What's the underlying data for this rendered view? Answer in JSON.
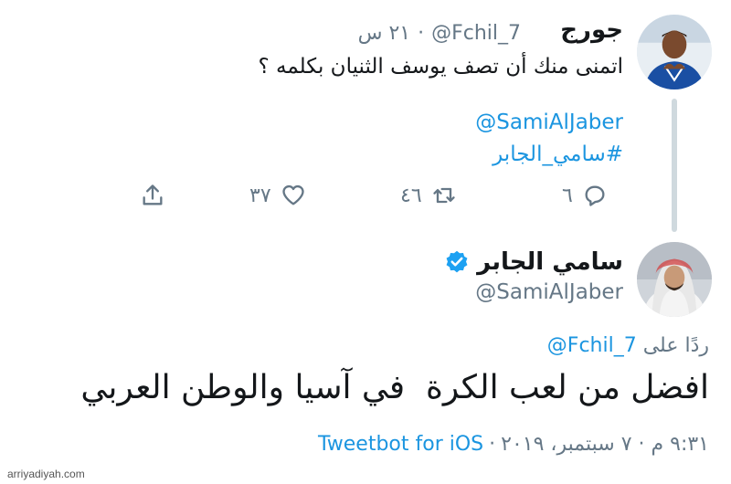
{
  "parent_tweet": {
    "display_name": "جورج",
    "handle": "@Fchil_7",
    "time": "٢١ س",
    "text": "اتمنى منك أن تصف يوسف الثنيان بكلمه ؟",
    "mention": "@SamiAlJaber",
    "hashtag": "#سامي_الجابر",
    "counts": {
      "replies": "٦",
      "retweets": "٤٦",
      "likes": "٣٧"
    }
  },
  "reply_tweet": {
    "display_name": "سامي الجابر",
    "handle": "@SamiAlJaber",
    "replying_prefix": "ردًا على",
    "replying_to": "@Fchil_7",
    "text": "افضل من لعب الكرة  في آسيا والوطن العربي",
    "timestamp": "٩:٣١ م · ٧ سبتمبر، ٢٠١٩",
    "source": "Tweetbot for iOS"
  },
  "watermark": "arriyadiyah.com",
  "colors": {
    "link": "#1b95e0",
    "secondary": "#657786",
    "verified": "#1da1f2"
  }
}
